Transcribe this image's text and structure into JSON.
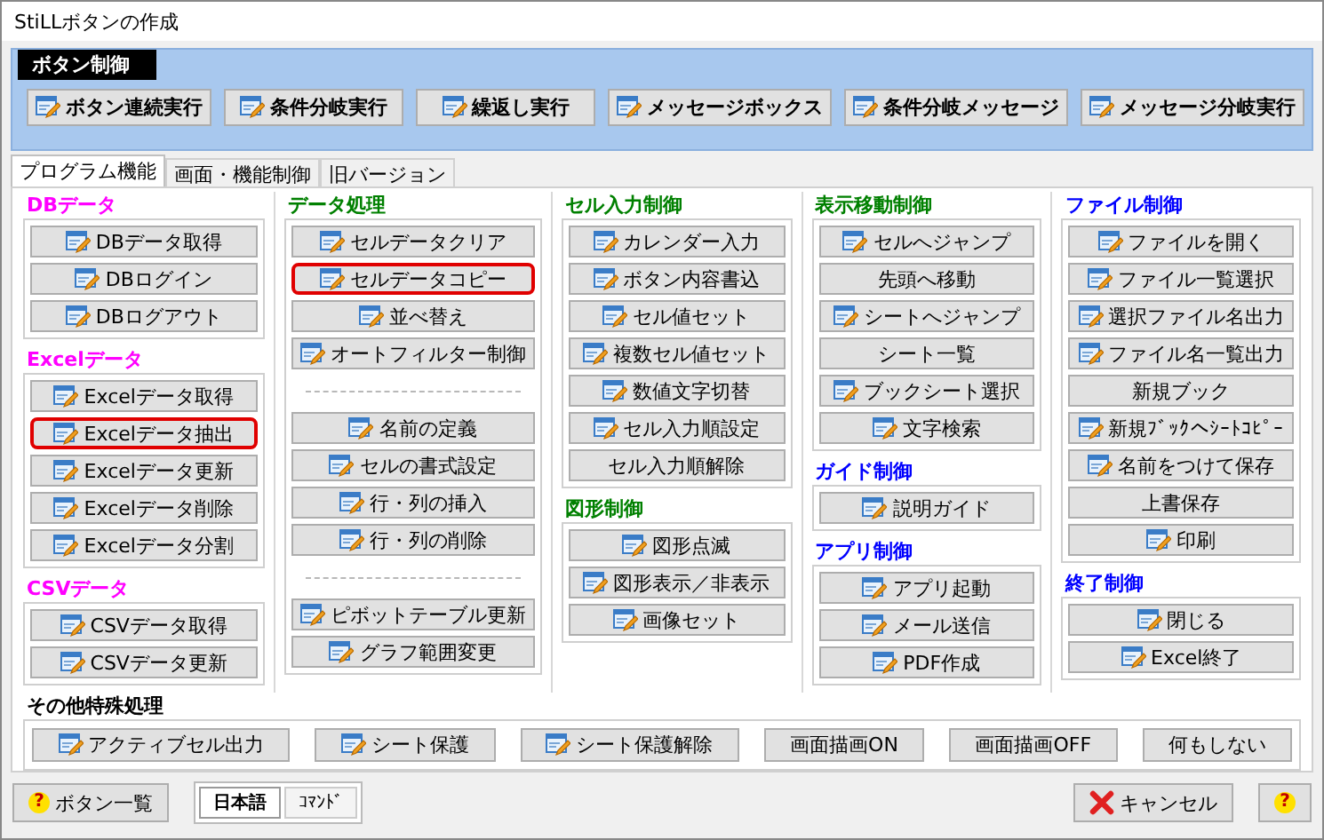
{
  "window": {
    "title": "StiLLボタンの作成"
  },
  "button_control": {
    "title": "ボタン制御",
    "buttons": [
      {
        "label": "ボタン連続実行",
        "icon": true
      },
      {
        "label": "条件分岐実行",
        "icon": true
      },
      {
        "label": "繰返し実行",
        "icon": true
      },
      {
        "label": "メッセージボックス",
        "icon": true
      },
      {
        "label": "条件分岐メッセージ",
        "icon": true
      },
      {
        "label": "メッセージ分岐実行",
        "icon": true
      }
    ]
  },
  "tabs": [
    {
      "label": "プログラム機能",
      "selected": true
    },
    {
      "label": "画面・機能制御",
      "selected": false
    },
    {
      "label": "旧バージョン",
      "selected": false
    }
  ],
  "columns": [
    {
      "sections": [
        {
          "title": "DBデータ",
          "color": "#ff00ff",
          "buttons": [
            {
              "kind": "button",
              "label": "DBデータ取得",
              "icon": true,
              "highlighted": false
            },
            {
              "kind": "button",
              "label": "DBログイン",
              "icon": true,
              "highlighted": false
            },
            {
              "kind": "button",
              "label": "DBログアウト",
              "icon": true,
              "highlighted": false
            }
          ]
        },
        {
          "title": "Excelデータ",
          "color": "#ff00ff",
          "buttons": [
            {
              "kind": "button",
              "label": "Excelデータ取得",
              "icon": true,
              "highlighted": false
            },
            {
              "kind": "button",
              "label": "Excelデータ抽出",
              "icon": true,
              "highlighted": true
            },
            {
              "kind": "button",
              "label": "Excelデータ更新",
              "icon": true,
              "highlighted": false
            },
            {
              "kind": "button",
              "label": "Excelデータ削除",
              "icon": true,
              "highlighted": false
            },
            {
              "kind": "button",
              "label": "Excelデータ分割",
              "icon": true,
              "highlighted": false
            }
          ]
        },
        {
          "title": "CSVデータ",
          "color": "#ff00ff",
          "buttons": [
            {
              "kind": "button",
              "label": "CSVデータ取得",
              "icon": true,
              "highlighted": false
            },
            {
              "kind": "button",
              "label": "CSVデータ更新",
              "icon": true,
              "highlighted": false
            }
          ]
        }
      ]
    },
    {
      "sections": [
        {
          "title": "データ処理",
          "color": "#008000",
          "buttons": [
            {
              "kind": "button",
              "label": "セルデータクリア",
              "icon": true,
              "highlighted": false
            },
            {
              "kind": "button",
              "label": "セルデータコピー",
              "icon": true,
              "highlighted": true
            },
            {
              "kind": "button",
              "label": "並べ替え",
              "icon": true,
              "highlighted": false
            },
            {
              "kind": "button",
              "label": "オートフィルター制御",
              "icon": true,
              "highlighted": false
            },
            {
              "kind": "separator"
            },
            {
              "kind": "button",
              "label": "名前の定義",
              "icon": true,
              "highlighted": false
            },
            {
              "kind": "button",
              "label": "セルの書式設定",
              "icon": true,
              "highlighted": false
            },
            {
              "kind": "button",
              "label": "行・列の挿入",
              "icon": true,
              "highlighted": false
            },
            {
              "kind": "button",
              "label": "行・列の削除",
              "icon": true,
              "highlighted": false
            },
            {
              "kind": "separator"
            },
            {
              "kind": "button",
              "label": "ピボットテーブル更新",
              "icon": true,
              "highlighted": false
            },
            {
              "kind": "button",
              "label": "グラフ範囲変更",
              "icon": true,
              "highlighted": false
            }
          ]
        }
      ]
    },
    {
      "sections": [
        {
          "title": "セル入力制御",
          "color": "#008000",
          "buttons": [
            {
              "kind": "button",
              "label": "カレンダー入力",
              "icon": true,
              "highlighted": false
            },
            {
              "kind": "button",
              "label": "ボタン内容書込",
              "icon": true,
              "highlighted": false
            },
            {
              "kind": "button",
              "label": "セル値セット",
              "icon": true,
              "highlighted": false
            },
            {
              "kind": "button",
              "label": "複数セル値セット",
              "icon": true,
              "highlighted": false
            },
            {
              "kind": "button",
              "label": "数値文字切替",
              "icon": true,
              "highlighted": false
            },
            {
              "kind": "button",
              "label": "セル入力順設定",
              "icon": true,
              "highlighted": false
            },
            {
              "kind": "button",
              "label": "セル入力順解除",
              "icon": false,
              "highlighted": false
            }
          ]
        },
        {
          "title": "図形制御",
          "color": "#008000",
          "buttons": [
            {
              "kind": "button",
              "label": "図形点滅",
              "icon": true,
              "highlighted": false
            },
            {
              "kind": "button",
              "label": "図形表示／非表示",
              "icon": true,
              "highlighted": false
            },
            {
              "kind": "button",
              "label": "画像セット",
              "icon": true,
              "highlighted": false
            }
          ]
        }
      ]
    },
    {
      "sections": [
        {
          "title": "表示移動制御",
          "color": "#008000",
          "buttons": [
            {
              "kind": "button",
              "label": "セルへジャンプ",
              "icon": true,
              "highlighted": false
            },
            {
              "kind": "button",
              "label": "先頭へ移動",
              "icon": false,
              "highlighted": false
            },
            {
              "kind": "button",
              "label": "シートへジャンプ",
              "icon": true,
              "highlighted": false
            },
            {
              "kind": "button",
              "label": "シート一覧",
              "icon": false,
              "highlighted": false
            },
            {
              "kind": "button",
              "label": "ブックシート選択",
              "icon": true,
              "highlighted": false
            },
            {
              "kind": "button",
              "label": "文字検索",
              "icon": true,
              "highlighted": false
            }
          ]
        },
        {
          "title": "ガイド制御",
          "color": "#0000ff",
          "buttons": [
            {
              "kind": "button",
              "label": "説明ガイド",
              "icon": true,
              "highlighted": false
            }
          ]
        },
        {
          "title": "アプリ制御",
          "color": "#0000ff",
          "buttons": [
            {
              "kind": "button",
              "label": "アプリ起動",
              "icon": true,
              "highlighted": false
            },
            {
              "kind": "button",
              "label": "メール送信",
              "icon": true,
              "highlighted": false
            },
            {
              "kind": "button",
              "label": "PDF作成",
              "icon": true,
              "highlighted": false
            }
          ]
        }
      ]
    },
    {
      "sections": [
        {
          "title": "ファイル制御",
          "color": "#0000ff",
          "buttons": [
            {
              "kind": "button",
              "label": "ファイルを開く",
              "icon": true,
              "highlighted": false
            },
            {
              "kind": "button",
              "label": "ファイル一覧選択",
              "icon": true,
              "highlighted": false
            },
            {
              "kind": "button",
              "label": "選択ファイル名出力",
              "icon": true,
              "highlighted": false
            },
            {
              "kind": "button",
              "label": "ファイル名一覧出力",
              "icon": true,
              "highlighted": false
            },
            {
              "kind": "button",
              "label": "新規ブック",
              "icon": false,
              "highlighted": false
            },
            {
              "kind": "button",
              "label": "新規ﾌﾞｯｸへｼｰﾄｺﾋﾟｰ",
              "icon": true,
              "highlighted": false
            },
            {
              "kind": "button",
              "label": "名前をつけて保存",
              "icon": true,
              "highlighted": false
            },
            {
              "kind": "button",
              "label": "上書保存",
              "icon": false,
              "highlighted": false
            },
            {
              "kind": "button",
              "label": "印刷",
              "icon": true,
              "highlighted": false
            }
          ]
        },
        {
          "title": "終了制御",
          "color": "#0000ff",
          "buttons": [
            {
              "kind": "button",
              "label": "閉じる",
              "icon": true,
              "highlighted": false
            },
            {
              "kind": "button",
              "label": "Excel終了",
              "icon": true,
              "highlighted": false
            }
          ]
        }
      ]
    }
  ],
  "other_section": {
    "title": "その他特殊処理",
    "color": "#000000",
    "buttons": [
      {
        "label": "アクティブセル出力",
        "icon": true
      },
      {
        "label": "シート保護",
        "icon": true
      },
      {
        "label": "シート保護解除",
        "icon": true
      },
      {
        "label": "画面描画ON",
        "icon": false
      },
      {
        "label": "画面描画OFF",
        "icon": false
      },
      {
        "label": "何もしない",
        "icon": false
      }
    ]
  },
  "footer": {
    "list_button": {
      "mark": "?",
      "label": "ボタン一覧"
    },
    "language_toggle": [
      {
        "label": "日本語",
        "selected": true
      },
      {
        "label": "ｺﾏﾝﾄﾞ",
        "selected": false
      }
    ],
    "cancel_button": "キャンセル",
    "help_button": "?"
  }
}
